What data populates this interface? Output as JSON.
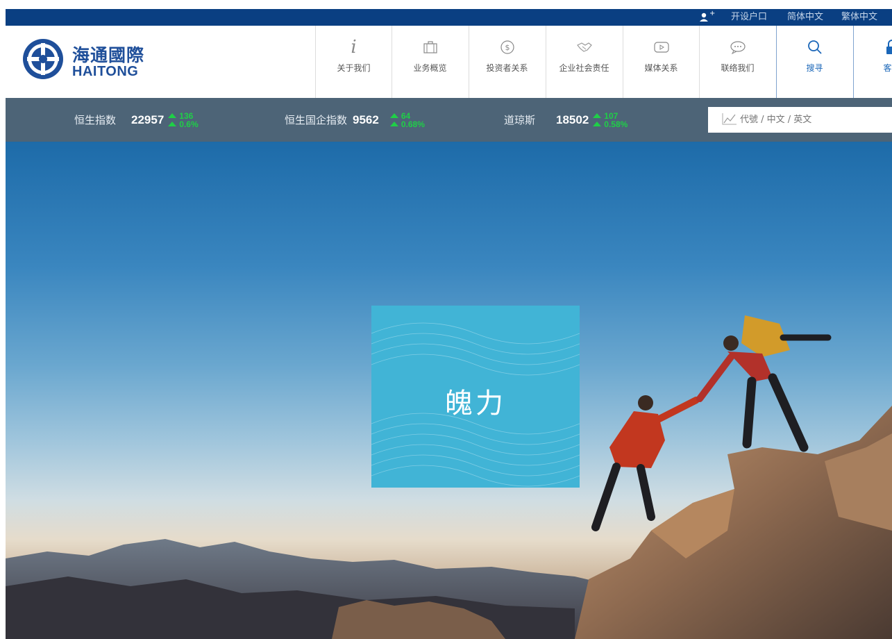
{
  "topbar": {
    "open_account": "开设户口",
    "simplified": "简体中文",
    "traditional": "繁体中文"
  },
  "logo": {
    "cn": "海通國際",
    "en": "HAITONG"
  },
  "nav": [
    {
      "label": "关于我们",
      "icon": "info-icon"
    },
    {
      "label": "业务概览",
      "icon": "briefcase-icon"
    },
    {
      "label": "投资者关系",
      "icon": "dollar-circle-icon"
    },
    {
      "label": "企业社会责任",
      "icon": "handshake-icon"
    },
    {
      "label": "媒体关系",
      "icon": "play-icon"
    },
    {
      "label": "联络我们",
      "icon": "chat-bubble-icon"
    },
    {
      "label": "搜寻",
      "icon": "search-icon"
    },
    {
      "label": "客户",
      "icon": "lock-icon"
    }
  ],
  "ticker": [
    {
      "name": "恒生指数",
      "value": "22957",
      "change": "136",
      "pct": "0.6%"
    },
    {
      "name": "恒生国企指数",
      "value": "9562",
      "change": "64",
      "pct": "0.68%"
    },
    {
      "name": "道琼斯",
      "value": "18502",
      "change": "107",
      "pct": "0.58%"
    }
  ],
  "search": {
    "placeholder": "代號 / 中文 / 英文"
  },
  "hero": {
    "promo_text": "魄力"
  },
  "colors": {
    "topbar": "#0a3f82",
    "brand": "#1f4f9a",
    "ticker_bg": "#4d6477",
    "up": "#1fcf47",
    "promo": "#41b4d6"
  }
}
